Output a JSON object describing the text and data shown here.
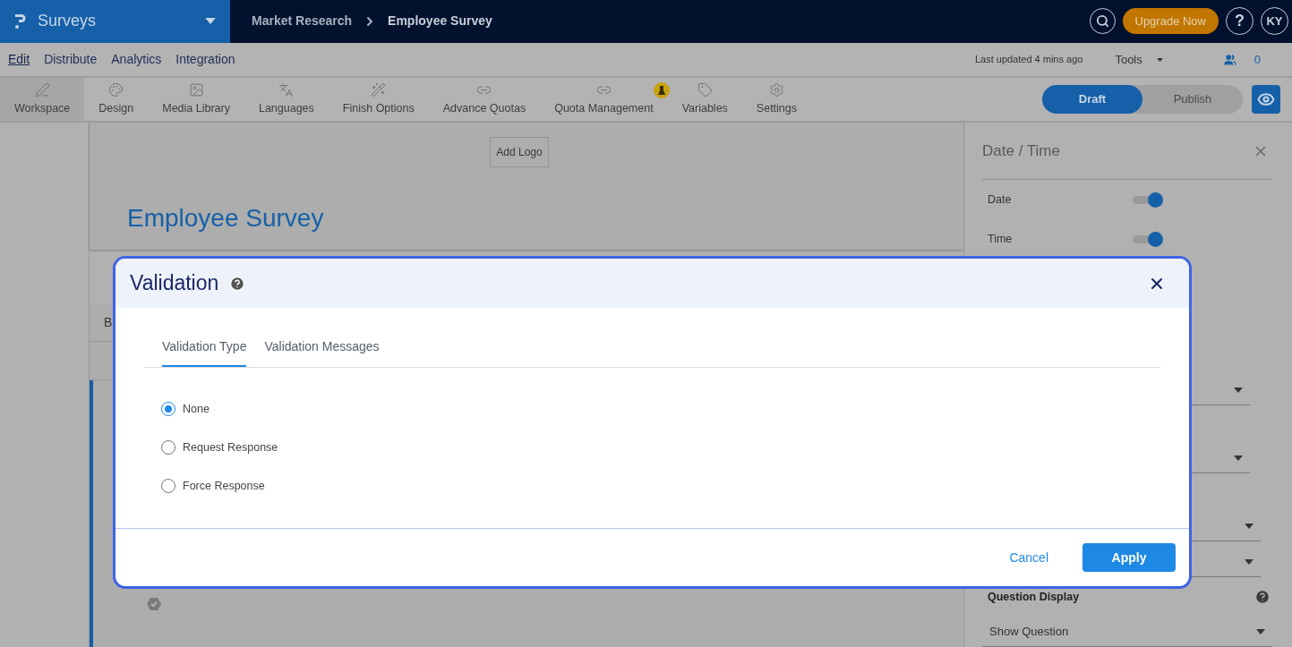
{
  "top_bar": {
    "product": "Surveys",
    "breadcrumb": [
      "Market Research",
      "Employee Survey"
    ],
    "upgrade_button": "Upgrade Now",
    "help": "?",
    "avatar": "KY"
  },
  "nav_tabs": [
    {
      "label": "Edit",
      "selected": true
    },
    {
      "label": "Distribute",
      "selected": false
    },
    {
      "label": "Analytics",
      "selected": false
    },
    {
      "label": "Integration",
      "selected": false
    }
  ],
  "status": {
    "last_updated": "Last updated 4 mins ago",
    "tools": "Tools",
    "collaborators": "0"
  },
  "toolbar": [
    {
      "label": "Workspace",
      "selected": true,
      "badge": false
    },
    {
      "label": "Design",
      "selected": false,
      "badge": false
    },
    {
      "label": "Media Library",
      "selected": false,
      "badge": false
    },
    {
      "label": "Languages",
      "selected": false,
      "badge": false
    },
    {
      "label": "Finish Options",
      "selected": false,
      "badge": false
    },
    {
      "label": "Advance Quotas",
      "selected": false,
      "badge": false
    },
    {
      "label": "Quota Management",
      "selected": false,
      "badge": true
    },
    {
      "label": "Variables",
      "selected": false,
      "badge": false
    },
    {
      "label": "Settings",
      "selected": false,
      "badge": false
    }
  ],
  "mode_toggle": [
    {
      "label": "Draft",
      "selected": true
    },
    {
      "label": "Publish",
      "selected": false
    }
  ],
  "survey": {
    "add_logo": "Add Logo",
    "title": "Employee Survey",
    "block_label": "B"
  },
  "side_panel": {
    "title": "Date / Time",
    "toggles": [
      {
        "label": "Date",
        "on": true
      },
      {
        "label": "Time",
        "on": true
      }
    ],
    "section": "Question Display",
    "display_select": "Show Question"
  },
  "dialog": {
    "title": "Validation",
    "tabs": [
      {
        "label": "Validation Type",
        "selected": true
      },
      {
        "label": "Validation Messages",
        "selected": false
      }
    ],
    "options": [
      {
        "label": "None",
        "selected": true
      },
      {
        "label": "Request Response",
        "selected": false
      },
      {
        "label": "Force Response",
        "selected": false
      }
    ],
    "cancel": "Cancel",
    "apply": "Apply"
  }
}
